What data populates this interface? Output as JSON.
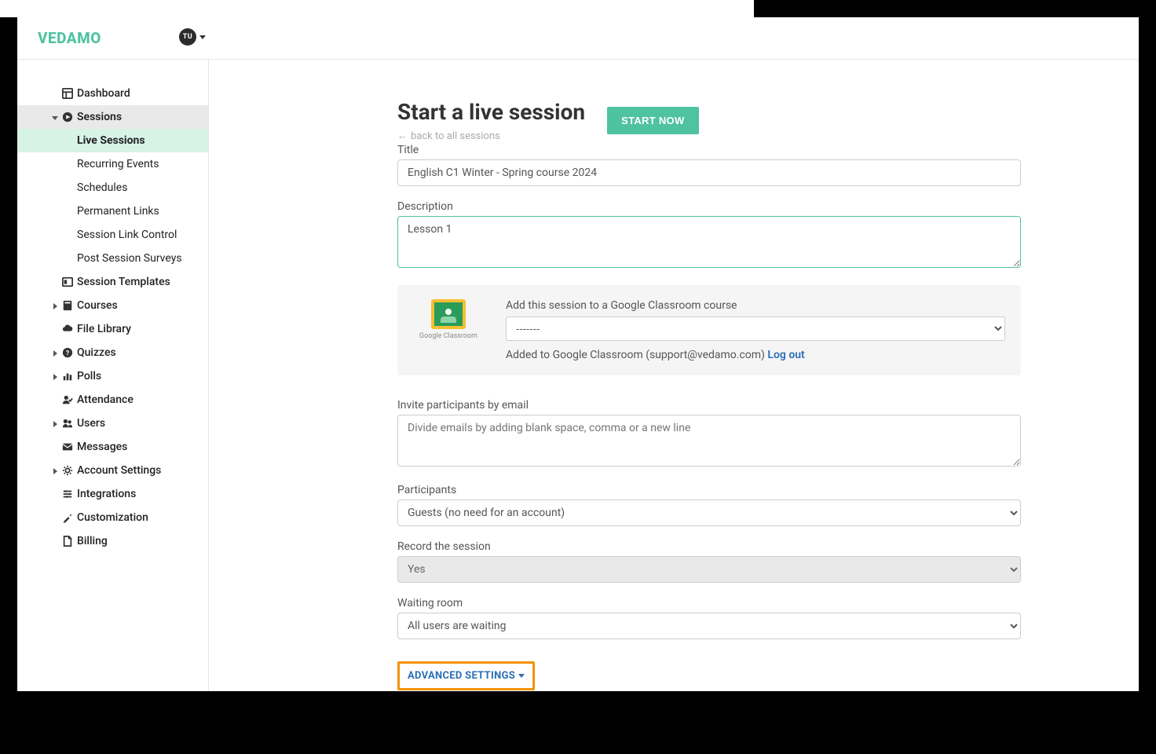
{
  "brand": "VEDAMO",
  "avatar_initials": "TU",
  "sidebar": {
    "items": [
      {
        "label": "Dashboard",
        "icon": "dashboard"
      },
      {
        "label": "Sessions",
        "icon": "play",
        "expandable": true,
        "expanded": true,
        "active_group": true,
        "children": [
          {
            "label": "Live Sessions",
            "active": true
          },
          {
            "label": "Recurring Events"
          },
          {
            "label": "Schedules"
          },
          {
            "label": "Permanent Links"
          },
          {
            "label": "Session Link Control"
          },
          {
            "label": "Post Session Surveys"
          }
        ]
      },
      {
        "label": "Session Templates",
        "icon": "template"
      },
      {
        "label": "Courses",
        "icon": "book",
        "expandable": true
      },
      {
        "label": "File Library",
        "icon": "cloud"
      },
      {
        "label": "Quizzes",
        "icon": "question",
        "expandable": true
      },
      {
        "label": "Polls",
        "icon": "chart",
        "expandable": true
      },
      {
        "label": "Attendance",
        "icon": "user-check"
      },
      {
        "label": "Users",
        "icon": "users",
        "expandable": true
      },
      {
        "label": "Messages",
        "icon": "envelope"
      },
      {
        "label": "Account Settings",
        "icon": "gear",
        "expandable": true
      },
      {
        "label": "Integrations",
        "icon": "sliders"
      },
      {
        "label": "Customization",
        "icon": "tools"
      },
      {
        "label": "Billing",
        "icon": "file"
      }
    ]
  },
  "page": {
    "title": "Start a live session",
    "start_button": "START NOW",
    "back_link": "back to all sessions",
    "fields": {
      "title_label": "Title",
      "title_value": "English C1 Winter - Spring course 2024",
      "description_label": "Description",
      "description_value": "Lesson 1",
      "invite_label": "Invite participants by email",
      "invite_placeholder": "Divide emails by adding blank space, comma or a new line",
      "participants_label": "Participants",
      "participants_value": "Guests (no need for an account)",
      "record_label": "Record the session",
      "record_value": "Yes",
      "waiting_label": "Waiting room",
      "waiting_value": "All users are waiting"
    },
    "google_classroom": {
      "caption": "Google Classroom",
      "add_label": "Add this session to a Google Classroom course",
      "select_value": "-------",
      "status_text": "Added to Google Classroom (support@vedamo.com) ",
      "logout_text": "Log out"
    },
    "advanced_settings": "ADVANCED SETTINGS"
  }
}
